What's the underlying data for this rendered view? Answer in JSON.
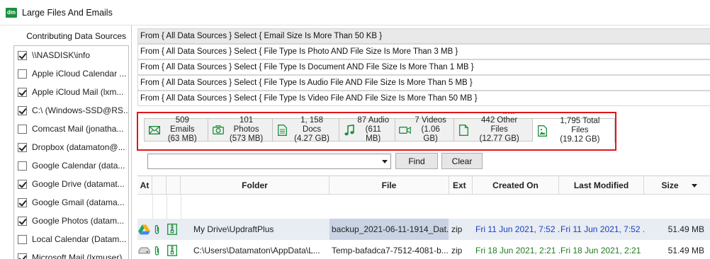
{
  "window": {
    "logo_text": "dm",
    "title": "Large Files And Emails"
  },
  "sidebar": {
    "header": "Contributing Data Sources",
    "items": [
      {
        "label": "\\\\NASDISK\\info",
        "checked": true
      },
      {
        "label": "Apple iCloud Calendar ...",
        "checked": false
      },
      {
        "label": "Apple iCloud Mail (lxm...",
        "checked": true
      },
      {
        "label": "C:\\ (Windows-SSD@RS...",
        "checked": true
      },
      {
        "label": "Comcast Mail (jonatha...",
        "checked": false
      },
      {
        "label": "Dropbox (datamaton@...",
        "checked": true
      },
      {
        "label": "Google Calendar (data...",
        "checked": false
      },
      {
        "label": "Google Drive (datamat...",
        "checked": true
      },
      {
        "label": "Google Gmail (datama...",
        "checked": true
      },
      {
        "label": "Google Photos (datam...",
        "checked": true
      },
      {
        "label": "Local Calendar (Datam...",
        "checked": false
      },
      {
        "label": "Microsoft Mail (lxmuser)",
        "checked": true
      }
    ]
  },
  "queries": [
    "From { All Data Sources } Select { Email Size Is More Than 50 KB }",
    "From { All Data Sources } Select { File Type Is Photo AND File Size Is More Than 3 MB }",
    "From { All Data Sources } Select { File Type Is Document AND File Size Is More Than 1 MB }",
    "From { All Data Sources } Select { File Type Is Audio File AND File Size Is More Than 5 MB }",
    "From { All Data Sources } Select { File Type Is Video File AND File Size Is More Than 50 MB }"
  ],
  "tabs": [
    {
      "line1": "509 Emails",
      "line2": "(63 MB)",
      "icon": "envelope-icon"
    },
    {
      "line1": "101 Photos",
      "line2": "(573 MB)",
      "icon": "camera-icon"
    },
    {
      "line1": "1, 158 Docs",
      "line2": "(4.27 GB)",
      "icon": "document-icon"
    },
    {
      "line1": "87 Audio",
      "line2": "(611 MB)",
      "icon": "music-note-icon"
    },
    {
      "line1": "7 Videos",
      "line2": "(1.06 GB)",
      "icon": "video-camera-icon"
    },
    {
      "line1": "442 Other Files",
      "line2": "(12.77 GB)",
      "icon": "file-icon"
    },
    {
      "line1": "1,795 Total Files",
      "line2": "(19.12 GB)",
      "icon": "image-file-icon",
      "active": true
    }
  ],
  "search": {
    "value": "",
    "find_label": "Find",
    "clear_label": "Clear"
  },
  "grid": {
    "columns": {
      "at": "At",
      "folder": "Folder",
      "file": "File",
      "ext": "Ext",
      "created": "Created On",
      "modified": "Last Modified",
      "size": "Size"
    },
    "rows": [
      {
        "source_icon": "google-drive-icon",
        "folder": "My Drive\\UpdraftPlus",
        "file": "backup_2021-06-11-1914_Dat...",
        "ext": "zip",
        "created": "Fri 11 Jun 2021, 7:52 ...",
        "modified": "Fri 11 Jun 2021, 7:52 ...",
        "size": "51.49 MB",
        "date_color": "blue"
      },
      {
        "source_icon": "local-disk-icon",
        "folder": "C:\\Users\\Datamaton\\AppData\\L...",
        "file": "Temp-bafadca7-7512-4081-b...",
        "ext": "zip",
        "created": "Fri 18 Jun 2021, 2:21 ...",
        "modified": "Fri 18 Jun 2021, 2:21 ...",
        "size": "51.49 MB",
        "date_color": "green"
      }
    ]
  },
  "colors": {
    "accent_green": "#1e8e3e",
    "highlight_red": "#e0161c",
    "date_blue": "#1a3fc0",
    "date_green": "#1f7a1f"
  }
}
